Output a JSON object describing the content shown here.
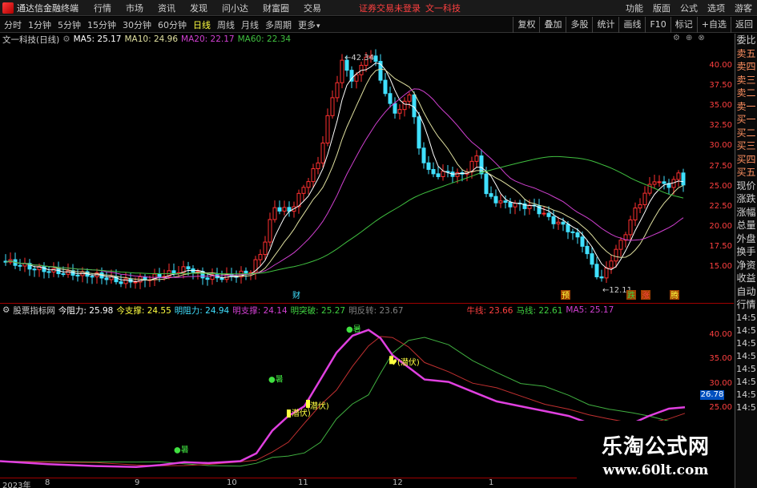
{
  "titlebar": {
    "app_title": "通达信金融终端",
    "menus": [
      "行情",
      "市场",
      "资讯",
      "发现",
      "问小达",
      "财富圈",
      "交易"
    ],
    "login_note": "证券交易未登录",
    "stock_name": "文一科技",
    "right_menus": [
      "功能",
      "版面",
      "公式",
      "选项"
    ],
    "guest": "游客"
  },
  "toolbar": {
    "periods": [
      "分时",
      "1分钟",
      "5分钟",
      "15分钟",
      "30分钟",
      "60分钟",
      "日线",
      "周线",
      "月线",
      "多周期",
      "更多"
    ],
    "active_period": "日线",
    "buttons": [
      "复权",
      "叠加",
      "多股",
      "统计",
      "画线",
      "F10",
      "标记",
      "+自选",
      "返回"
    ]
  },
  "main_chart": {
    "stock_label": "文一科技(日线)",
    "ma5_label": "MA5: 25.17",
    "ma10_label": "MA10: 24.96",
    "ma20_label": "MA20: 22.17",
    "ma60_label": "MA60: 22.34",
    "high_label": "42.34",
    "low_label": "12.11",
    "axis_ticks": [
      "40.00",
      "37.50",
      "35.00",
      "32.50",
      "30.00",
      "27.50",
      "25.00",
      "22.50",
      "20.00",
      "17.50",
      "15.00"
    ],
    "markers": [
      "财",
      "预",
      "跌",
      "涨",
      "腾"
    ]
  },
  "side_panel": {
    "items_top": [
      "委比",
      "卖五",
      "卖四",
      "卖三",
      "卖二",
      "卖一",
      "买一",
      "买二",
      "买三",
      "买四",
      "买五",
      "现价",
      "涨跌",
      "涨幅",
      "总量",
      "外盘",
      "换手",
      "净资",
      "收益"
    ],
    "items_bottom": [
      "自动",
      "行情"
    ],
    "times": [
      "14:5",
      "14:5",
      "14:5",
      "14:5",
      "14:5",
      "14:5",
      "14:5",
      "14:5"
    ]
  },
  "indicator": {
    "name": "股票指标网",
    "today_resist": "今阻力: 25.98",
    "today_support": "今支撑: 24.55",
    "tomorrow_resist": "明阻力: 24.94",
    "tomorrow_support": "明支撑: 24.14",
    "tomorrow_break": "明突破: 25.27",
    "tomorrow_reverse": "明反转: 23.67",
    "ox_line": "牛线: 23.66",
    "horse_line": "马线: 22.61",
    "ma5": "MA5: 25.17",
    "axis_ticks": [
      "40.00",
      "35.00",
      "30.00",
      "25.00"
    ],
    "current_value": "26.78",
    "annotations": {
      "shu1": "暑",
      "shu2": "暑",
      "shu3": "暑",
      "qianfu1": "潜伏",
      "qianfu2": "潜伏",
      "qianfu3": "潜伏"
    }
  },
  "date_axis": {
    "labels": [
      "2023年",
      "8",
      "9",
      "10",
      "11",
      "12",
      "1"
    ]
  },
  "watermark": {
    "title": "乐淘公式网",
    "url": "www.60lt.com"
  },
  "colors": {
    "up": "#ff3030",
    "down": "#40e0ff",
    "ma5": "#ffffff",
    "ma10": "#e0e0a0",
    "ma20": "#d040d0",
    "ma60": "#40c040",
    "indicator_main": "#e040e0",
    "ox_line": "#c03030",
    "horse_line": "#40b040"
  }
}
